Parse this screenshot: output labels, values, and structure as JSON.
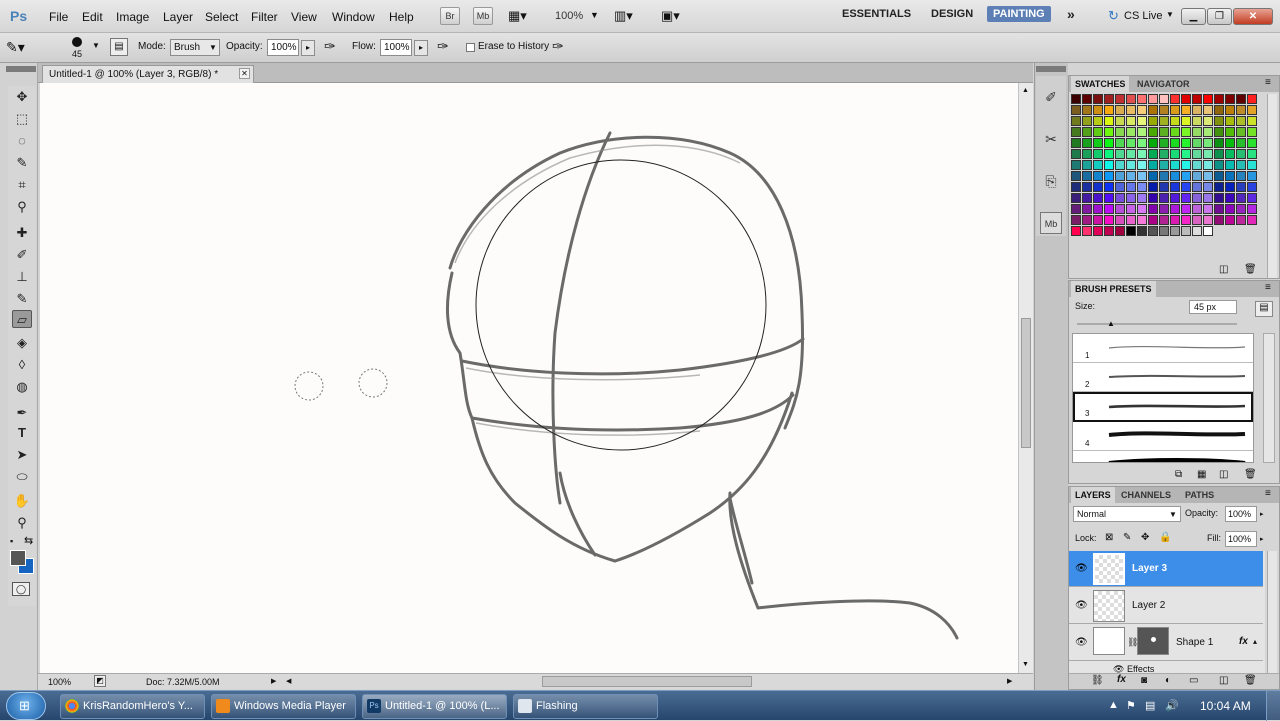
{
  "menubar": {
    "app_logo": "Ps",
    "items": [
      "File",
      "Edit",
      "Image",
      "Layer",
      "Select",
      "Filter",
      "View",
      "Window",
      "Help"
    ],
    "bridge_button": "Br",
    "minibridge_button": "Mb",
    "zoom_value": "100%",
    "workspaces": [
      "ESSENTIALS",
      "DESIGN",
      "PAINTING"
    ],
    "active_workspace": "PAINTING",
    "more_workspaces": "»",
    "cs_live": "CS Live"
  },
  "options": {
    "brush_size": "45",
    "mode_label": "Mode:",
    "mode_value": "Brush",
    "opacity_label": "Opacity:",
    "opacity_value": "100%",
    "flow_label": "Flow:",
    "flow_value": "100%",
    "erase_history_label": "Erase to History"
  },
  "document": {
    "tab_title": "Untitled-1 @ 100% (Layer 3, RGB/8) *",
    "zoom": "100%",
    "doc_size": "Doc: 7.32M/5.00M"
  },
  "swatches_panel": {
    "tabs": [
      "SWATCHES",
      "NAVIGATOR"
    ]
  },
  "brush_presets_panel": {
    "tab": "BRUSH PRESETS",
    "size_label": "Size:",
    "size_value": "45 px",
    "presets": [
      "1",
      "2",
      "3",
      "4"
    ]
  },
  "layers_panel": {
    "tabs": [
      "LAYERS",
      "CHANNELS",
      "PATHS"
    ],
    "blend_mode": "Normal",
    "opacity_label": "Opacity:",
    "opacity_value": "100%",
    "lock_label": "Lock:",
    "fill_label": "Fill:",
    "fill_value": "100%",
    "layers": [
      {
        "name": "Layer 3",
        "selected": true
      },
      {
        "name": "Layer 2",
        "selected": false
      },
      {
        "name": "Shape 1",
        "selected": false
      }
    ],
    "effects_label": "Effects",
    "fx_label": "fx"
  },
  "taskbar": {
    "items": [
      "KrisRandomHero's Y...",
      "Windows Media Player",
      "Untitled-1 @ 100% (L...",
      "Flashing"
    ],
    "clock": "10:04 AM"
  }
}
